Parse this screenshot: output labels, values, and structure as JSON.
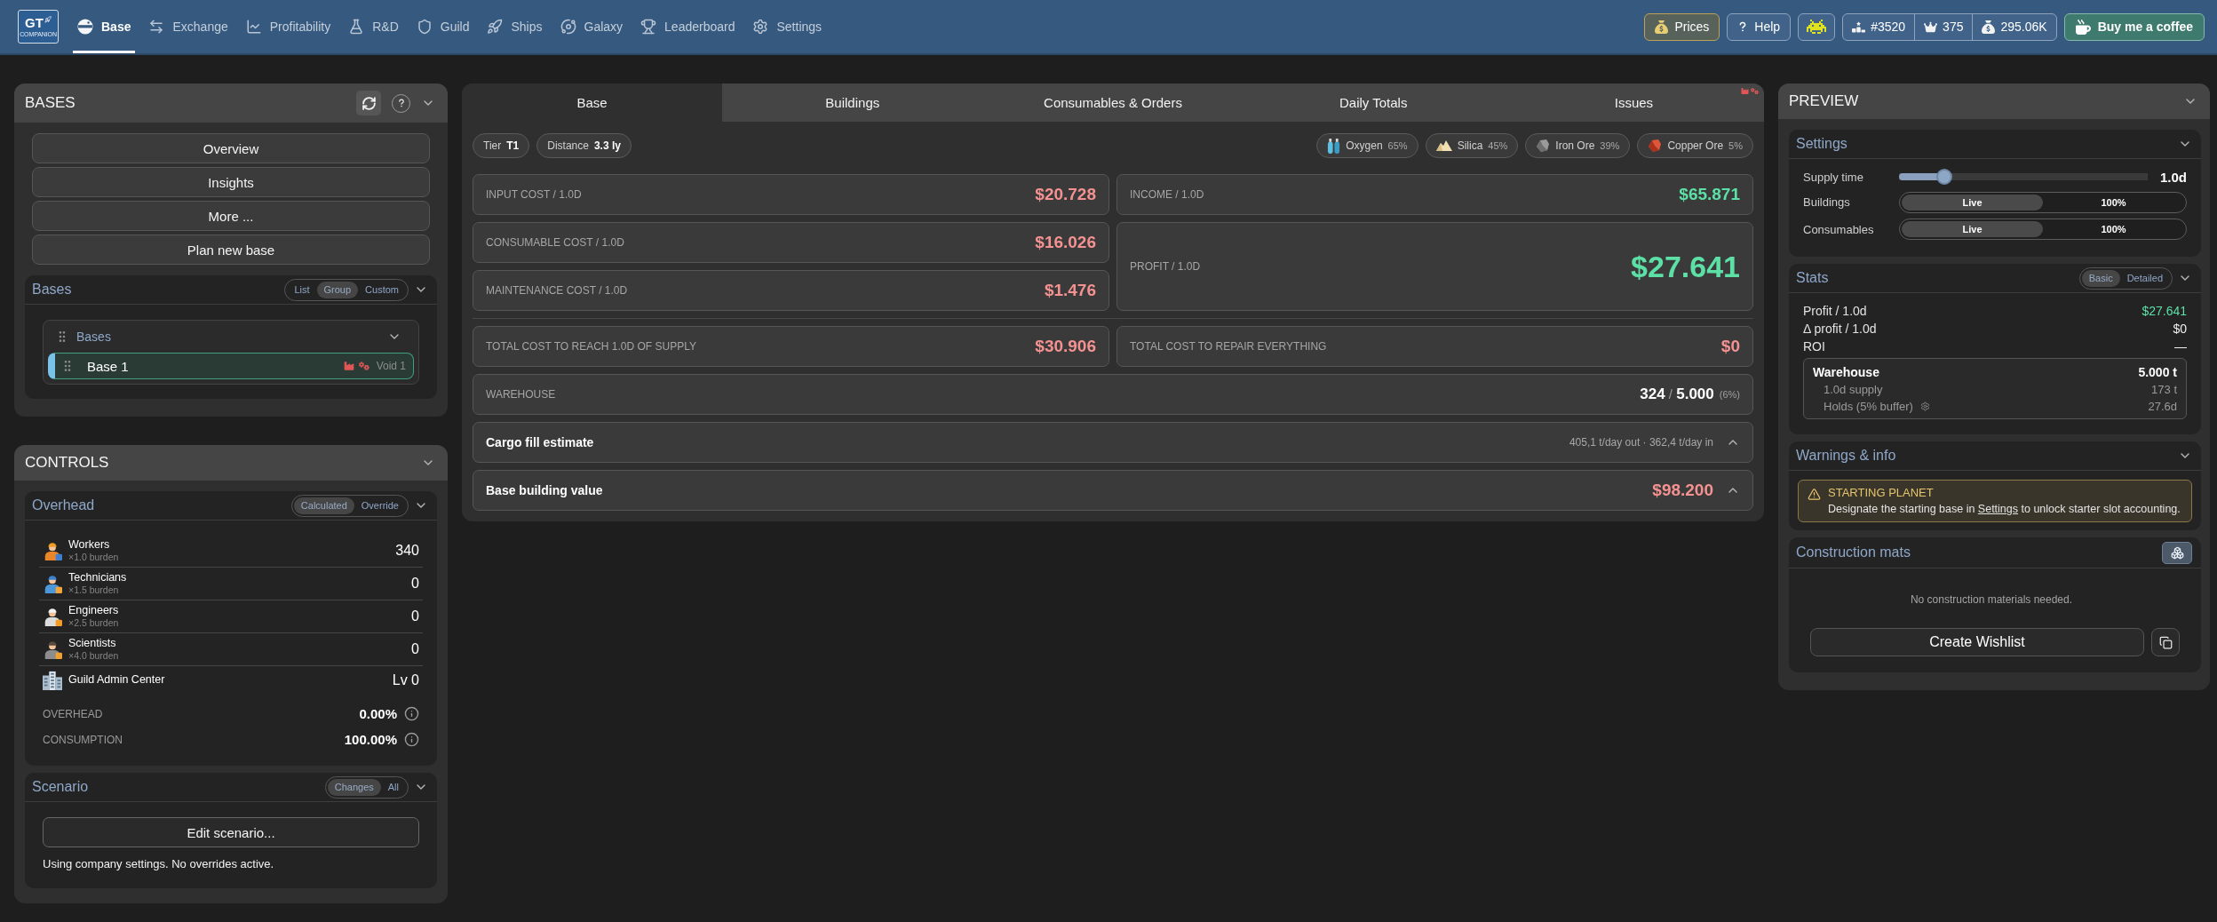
{
  "header": {
    "logo": {
      "title": "GT",
      "subtitle": "COMPANION"
    },
    "nav": [
      {
        "label": "Base",
        "selected": true
      },
      {
        "label": "Exchange",
        "selected": false
      },
      {
        "label": "Profitability",
        "selected": false
      },
      {
        "label": "R&D",
        "selected": false
      },
      {
        "label": "Guild",
        "selected": false
      },
      {
        "label": "Ships",
        "selected": false
      },
      {
        "label": "Galaxy",
        "selected": false
      },
      {
        "label": "Leaderboard",
        "selected": false
      },
      {
        "label": "Settings",
        "selected": false
      }
    ],
    "tools": [
      {
        "label": "Prices",
        "highlighted": true
      },
      {
        "label": "Help",
        "highlighted": false
      }
    ],
    "stats": [
      {
        "value": "#3520"
      },
      {
        "value": "375"
      },
      {
        "value": "295.06K"
      }
    ],
    "coffee": "Buy me a coffee"
  },
  "bases_panel": {
    "title": "BASES",
    "actions": [
      "Overview",
      "Insights",
      "More ...",
      "Plan new base"
    ],
    "list": {
      "title": "Bases",
      "views": [
        {
          "label": "List",
          "selected": false
        },
        {
          "label": "Group",
          "selected": true
        },
        {
          "label": "Custom",
          "selected": false
        }
      ],
      "groups": [
        {
          "title": "Bases",
          "bases": [
            {
              "name": "Base 1",
              "location": "Void 1",
              "selected": true,
              "issues": true
            }
          ]
        }
      ]
    }
  },
  "controls_panel": {
    "title": "CONTROLS",
    "overhead": {
      "title": "Overhead",
      "modes": [
        {
          "label": "Calculated",
          "selected": true
        },
        {
          "label": "Override",
          "selected": false
        }
      ],
      "staff": [
        {
          "name": "Workers",
          "burden": "×1.0 burden",
          "count": "340"
        },
        {
          "name": "Technicians",
          "burden": "×1.5 burden",
          "count": "0"
        },
        {
          "name": "Engineers",
          "burden": "×2.5 burden",
          "count": "0"
        },
        {
          "name": "Scientists",
          "burden": "×4.0 burden",
          "count": "0"
        }
      ],
      "facility": {
        "name": "Guild Admin Center",
        "value": "Lv 0"
      },
      "totals": [
        {
          "label": "OVERHEAD",
          "value": "0.00%"
        },
        {
          "label": "CONSUMPTION",
          "value": "100.00%"
        }
      ]
    },
    "scenario": {
      "title": "Scenario",
      "modes": [
        {
          "label": "Changes",
          "selected": true
        },
        {
          "label": "All",
          "selected": false
        }
      ],
      "button": "Edit scenario...",
      "note": "Using company settings. No overrides active."
    }
  },
  "main_panel": {
    "tabs": [
      {
        "label": "Base",
        "selected": true,
        "alert": false
      },
      {
        "label": "Buildings",
        "selected": false,
        "alert": false
      },
      {
        "label": "Consumables & Orders",
        "selected": false,
        "alert": false
      },
      {
        "label": "Daily Totals",
        "selected": false,
        "alert": false
      },
      {
        "label": "Issues",
        "selected": false,
        "alert": true
      }
    ],
    "chips": [
      {
        "label": "Tier",
        "value": "T1"
      },
      {
        "label": "Distance",
        "value": "3.3 ly"
      }
    ],
    "resources": [
      {
        "name": "Oxygen",
        "share": "65%"
      },
      {
        "name": "Silica",
        "share": "45%"
      },
      {
        "name": "Iron Ore",
        "share": "39%"
      },
      {
        "name": "Copper Ore",
        "share": "5%"
      }
    ],
    "costs": [
      {
        "label": "INPUT COST / 1.0D",
        "value": "$20.728",
        "kind": "cost"
      },
      {
        "label": "CONSUMABLE COST / 1.0D",
        "value": "$16.026",
        "kind": "cost"
      },
      {
        "label": "MAINTENANCE COST / 1.0D",
        "value": "$1.476",
        "kind": "cost"
      }
    ],
    "earnings": [
      {
        "label": "INCOME / 1.0D",
        "value": "$65.871",
        "kind": "income"
      },
      {
        "label": "PROFIT / 1.0D",
        "value": "$27.641",
        "kind": "profit"
      }
    ],
    "totals": [
      {
        "label": "TOTAL COST TO REACH 1.0D OF SUPPLY",
        "value": "$30.906",
        "kind": "cost"
      },
      {
        "label": "TOTAL COST TO REPAIR EVERYTHING",
        "value": "$0",
        "kind": "cost"
      }
    ],
    "warehouse": {
      "label": "WAREHOUSE",
      "amount": "**324** / **5.000**",
      "percent": "(6%)"
    },
    "sections": [
      {
        "title": "Cargo fill estimate",
        "summary": "405,1 t/day out · 362,4 t/day in",
        "kind": "info",
        "expanded": false
      },
      {
        "title": "Base building value",
        "summary": "$98.200",
        "kind": "cost",
        "expanded": false
      }
    ]
  },
  "preview_panel": {
    "title": "PREVIEW",
    "settings": {
      "title": "Settings",
      "supply": {
        "label": "Supply time",
        "level": 0.16,
        "value": "1.0d"
      },
      "sources": [
        {
          "label": "Buildings",
          "options": [
            {
              "label": "Live",
              "selected": true
            },
            {
              "label": "100%",
              "selected": false
            }
          ]
        },
        {
          "label": "Consumables",
          "options": [
            {
              "label": "Live",
              "selected": true
            },
            {
              "label": "100%",
              "selected": false
            }
          ]
        }
      ]
    },
    "stats": {
      "title": "Stats",
      "modes": [
        {
          "label": "Basic",
          "selected": true
        },
        {
          "label": "Detailed",
          "selected": false
        }
      ],
      "rows": [
        {
          "label": "Profit / 1.0d",
          "value": "$27.641",
          "kind": "gain"
        },
        {
          "label": "Δ profit / 1.0d",
          "value": "$0",
          "kind": "plain"
        },
        {
          "label": "ROI",
          "value": "—",
          "kind": "plain"
        }
      ],
      "warehouse": {
        "label": "Warehouse",
        "value": "5.000 t",
        "rows": [
          {
            "label": "1.0d supply",
            "value": "173 t",
            "kind": "plain"
          },
          {
            "label": "Holds (5% buffer)",
            "value": "27.6d",
            "kind": "configurable"
          }
        ]
      }
    },
    "warnings": {
      "title": "Warnings & info",
      "items": [
        {
          "title": "STARTING PLANET",
          "before": "Designate the starting base in ",
          "link": "Settings",
          "after": " to unlock starter slot accounting."
        }
      ]
    },
    "construction": {
      "title": "Construction mats",
      "empty": "No construction materials needed.",
      "button": "Create Wishlist"
    }
  }
}
